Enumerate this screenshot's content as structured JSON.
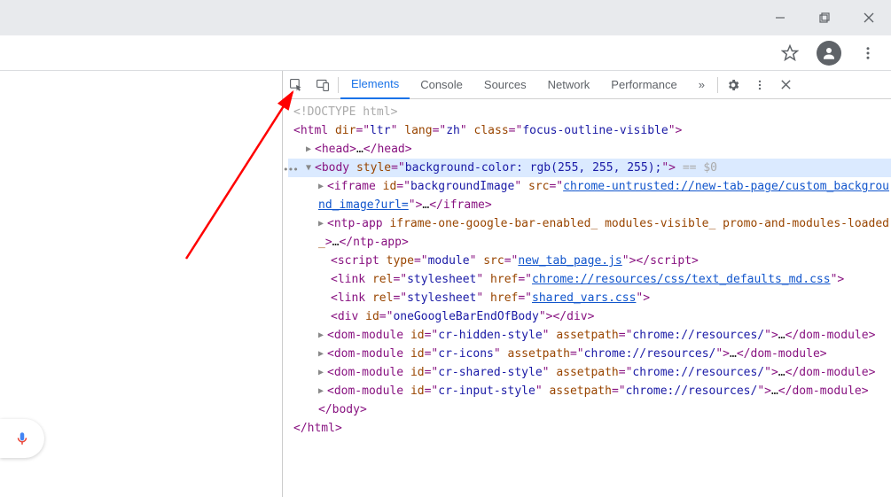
{
  "window": {
    "minimize": "−",
    "maximize": "❐",
    "close": "✕"
  },
  "devtools": {
    "tabs": {
      "elements": "Elements",
      "console": "Console",
      "sources": "Sources",
      "network": "Network",
      "performance": "Performance",
      "more": "»"
    }
  },
  "dom": {
    "doctype": "<!DOCTYPE html>",
    "html_open": {
      "dir_n": "dir",
      "dir_v": "ltr",
      "lang_n": "lang",
      "lang_v": "zh",
      "class_n": "class",
      "class_v": "focus-outline-visible"
    },
    "head": {
      "open": "head",
      "ellipsis": "…",
      "close": "head"
    },
    "body_open": {
      "tag": "body",
      "style_n": "style",
      "style_v": "background-color: rgb(255, 255, 255);",
      "eq": " == $0"
    },
    "iframe": {
      "tag": "iframe",
      "id_n": "id",
      "id_v": "backgroundImage",
      "src_n": "src",
      "src_v": "chrome-untrusted://new-tab-page/custom_background_image?url=",
      "ellipsis": "…",
      "close": "iframe"
    },
    "ntpapp": {
      "tag": "ntp-app",
      "attrs": "iframe-one-google-bar-enabled_ modules-visible_ promo-and-modules-loaded_",
      "ellipsis": "…",
      "close": "ntp-app"
    },
    "script": {
      "tag": "script",
      "type_n": "type",
      "type_v": "module",
      "src_n": "src",
      "src_v": "new_tab_page.js"
    },
    "link1": {
      "tag": "link",
      "rel_n": "rel",
      "rel_v": "stylesheet",
      "href_n": "href",
      "href_v": "chrome://resources/css/text_defaults_md.css"
    },
    "link2": {
      "tag": "link",
      "rel_n": "rel",
      "rel_v": "stylesheet",
      "href_n": "href",
      "href_v": "shared_vars.css"
    },
    "div": {
      "tag": "div",
      "id_n": "id",
      "id_v": "oneGoogleBarEndOfBody"
    },
    "dm1": {
      "tag": "dom-module",
      "id_n": "id",
      "id_v": "cr-hidden-style",
      "ap_n": "assetpath",
      "ap_v": "chrome://resources/",
      "ellipsis": "…",
      "close": "dom-module"
    },
    "dm2": {
      "tag": "dom-module",
      "id_n": "id",
      "id_v": "cr-icons",
      "ap_n": "assetpath",
      "ap_v": "chrome://resources/",
      "ellipsis": "…",
      "close": "dom-module"
    },
    "dm3": {
      "tag": "dom-module",
      "id_n": "id",
      "id_v": "cr-shared-style",
      "ap_n": "assetpath",
      "ap_v": "chrome://resources/",
      "ellipsis": "…",
      "close": "dom-module"
    },
    "dm4": {
      "tag": "dom-module",
      "id_n": "id",
      "id_v": "cr-input-style",
      "ap_n": "assetpath",
      "ap_v": "chrome://resources/",
      "ellipsis": "…",
      "close": "dom-module"
    },
    "body_close": "body",
    "html_close": "html"
  }
}
